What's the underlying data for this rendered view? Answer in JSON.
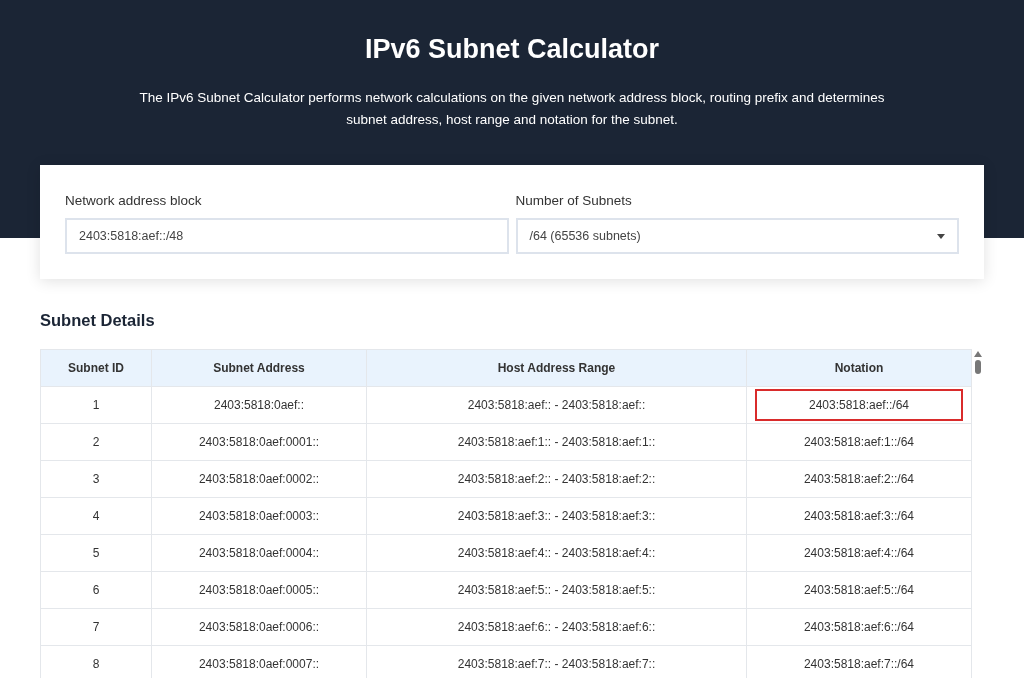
{
  "header": {
    "title": "IPv6 Subnet Calculator",
    "description": "The IPv6 Subnet Calculator performs network calculations on the given network address block, routing prefix and determines subnet address, host range and notation for the subnet."
  },
  "form": {
    "network_label": "Network address block",
    "network_value": "2403:5818:aef::/48",
    "subnets_label": "Number of Subnets",
    "subnets_value": "/64 (65536 subnets)"
  },
  "details": {
    "title": "Subnet Details",
    "columns": [
      "Subnet ID",
      "Subnet Address",
      "Host Address Range",
      "Notation"
    ],
    "rows": [
      {
        "cells": [
          "1",
          "2403:5818:0aef::",
          "2403:5818:aef:: - 2403:5818:aef::",
          "2403:5818:aef::/64"
        ],
        "highlighted": true
      },
      {
        "cells": [
          "2",
          "2403:5818:0aef:0001::",
          "2403:5818:aef:1:: - 2403:5818:aef:1::",
          "2403:5818:aef:1::/64"
        ],
        "highlighted": false
      },
      {
        "cells": [
          "3",
          "2403:5818:0aef:0002::",
          "2403:5818:aef:2:: - 2403:5818:aef:2::",
          "2403:5818:aef:2::/64"
        ],
        "highlighted": false
      },
      {
        "cells": [
          "4",
          "2403:5818:0aef:0003::",
          "2403:5818:aef:3:: - 2403:5818:aef:3::",
          "2403:5818:aef:3::/64"
        ],
        "highlighted": false
      },
      {
        "cells": [
          "5",
          "2403:5818:0aef:0004::",
          "2403:5818:aef:4:: - 2403:5818:aef:4::",
          "2403:5818:aef:4::/64"
        ],
        "highlighted": false
      },
      {
        "cells": [
          "6",
          "2403:5818:0aef:0005::",
          "2403:5818:aef:5:: - 2403:5818:aef:5::",
          "2403:5818:aef:5::/64"
        ],
        "highlighted": false
      },
      {
        "cells": [
          "7",
          "2403:5818:0aef:0006::",
          "2403:5818:aef:6:: - 2403:5818:aef:6::",
          "2403:5818:aef:6::/64"
        ],
        "highlighted": false
      },
      {
        "cells": [
          "8",
          "2403:5818:0aef:0007::",
          "2403:5818:aef:7:: - 2403:5818:aef:7::",
          "2403:5818:aef:7::/64"
        ],
        "highlighted": false
      }
    ]
  }
}
